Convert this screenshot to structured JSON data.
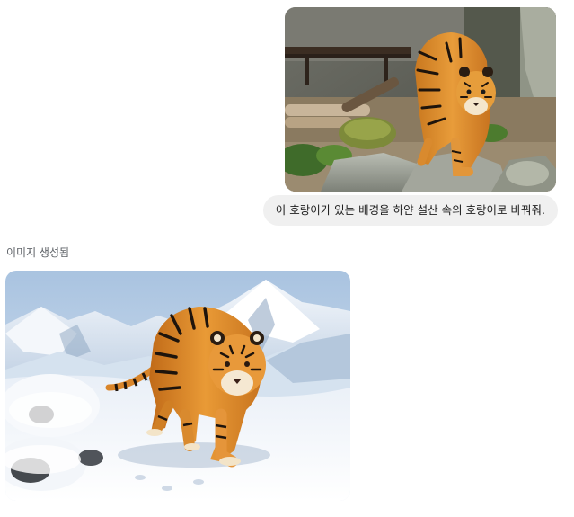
{
  "conversation": {
    "user_message": {
      "image_alt": "tiger-on-rocks-photo",
      "text": "이 호랑이가 있는 배경을 하얀 설산 속의 호랑이로 바꿔줘."
    },
    "model_response": {
      "status": "이미지 생성됨",
      "image_alt": "tiger-in-snowy-mountains-image"
    }
  }
}
